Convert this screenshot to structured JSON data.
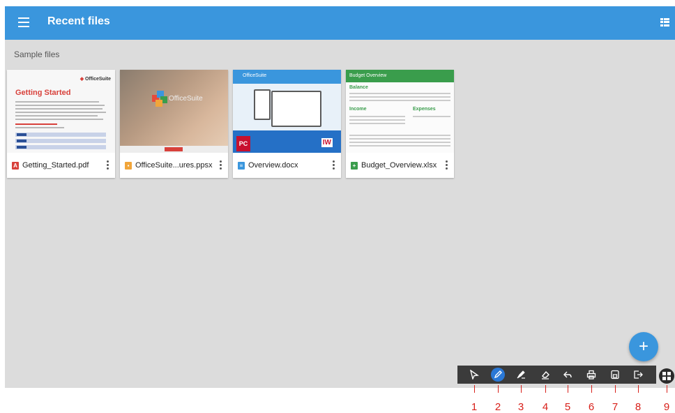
{
  "app": {
    "title": "Recent files",
    "section": "Sample files",
    "accent": "#3a96dd"
  },
  "files": [
    {
      "name": "Getting_Started.pdf",
      "icon": "pdf-icon",
      "color": "#d8413b",
      "thumb_title": "Getting Started",
      "thumb_brand": "OfficeSuite"
    },
    {
      "name": "OfficeSuite...ures.ppsx",
      "icon": "ppsx-icon",
      "color": "#f1a53a",
      "thumb_brand": "OfficeSuite"
    },
    {
      "name": "Overview.docx",
      "icon": "docx-icon",
      "color": "#3a96dd",
      "thumb_brand": "OfficeSuite",
      "thumb_pc": "PC",
      "thumb_iw": "IW"
    },
    {
      "name": "Budget_Overview.xlsx",
      "icon": "xlsx-icon",
      "color": "#3a9d4c",
      "thumb_title": "Budget Overview",
      "thumb_balance": "Balance",
      "thumb_income": "Income",
      "thumb_expenses": "Expenses"
    }
  ],
  "fab": {
    "label": "+"
  },
  "toolbar": {
    "tools": [
      "cursor-icon",
      "pen-icon",
      "highlighter-icon",
      "eraser-icon",
      "undo-icon",
      "print-icon",
      "save-icon",
      "exit-icon"
    ],
    "active": "pen-icon"
  },
  "annotations": [
    "1",
    "2",
    "3",
    "4",
    "5",
    "6",
    "7",
    "8",
    "9"
  ],
  "annotation_color": "#d8201a"
}
